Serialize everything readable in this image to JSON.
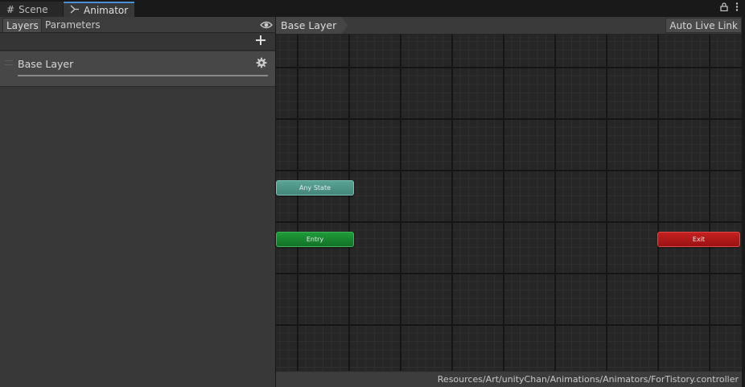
{
  "tabs": [
    {
      "label": "Scene",
      "icon": "grid-icon"
    },
    {
      "label": "Animator",
      "icon": "animator-icon"
    }
  ],
  "window_icons": [
    "lock-icon",
    "kebab-menu-icon"
  ],
  "left_panel": {
    "tabs": [
      "Layers",
      "Parameters"
    ],
    "visibility_icon": "eye-icon",
    "add_icon": "plus-icon",
    "layers": [
      {
        "name": "Base Layer",
        "settings_icon": "gear-icon"
      }
    ]
  },
  "graph": {
    "breadcrumb": "Base Layer",
    "auto_live_link_label": "Auto Live Link",
    "nodes": {
      "any_state": "Any State",
      "entry": "Entry",
      "exit": "Exit"
    },
    "controller_path": "Resources/Art/unityChan/Animations/Animators/ForTistory.controller"
  },
  "colors": {
    "any_state": "#4f9a8b",
    "entry": "#1a8a32",
    "exit": "#b41a1a",
    "active_tab_accent": "#4a8fd9"
  }
}
